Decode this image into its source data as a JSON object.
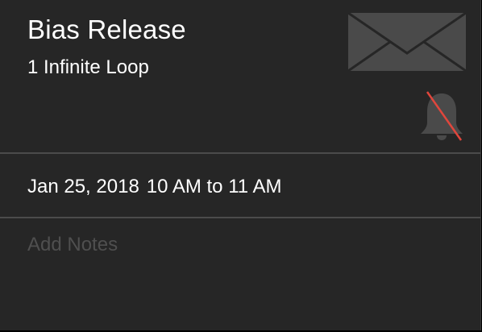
{
  "event": {
    "title": "Bias Release",
    "location": "1 Infinite Loop",
    "date": "Jan 25, 2018",
    "time_range": "10 AM to 11 AM"
  },
  "notes": {
    "placeholder": "Add Notes",
    "value": ""
  },
  "icons": {
    "mail": "mail-envelope-icon",
    "alert": "bell-muted-icon"
  },
  "colors": {
    "background": "#262626",
    "text": "#ffffff",
    "icon": "#4a4a4a",
    "mute_slash": "#e0463c",
    "placeholder": "#4f4f4f",
    "divider": "#4b4b4b"
  }
}
